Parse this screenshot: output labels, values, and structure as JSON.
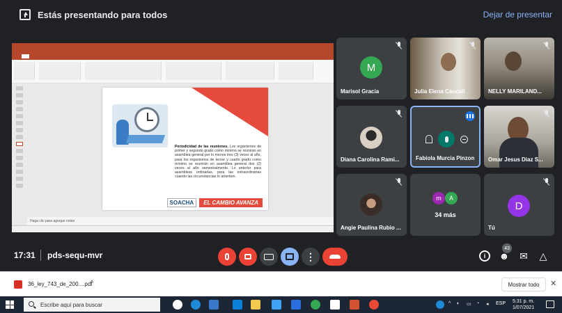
{
  "banner": {
    "presenting_text": "Estás presentando para todos",
    "stop_label": "Dejar de presentar"
  },
  "slide": {
    "heading": "Periodicidad de las reuniones.",
    "body": "Los organismos de primer y segundo grado como mínimo se reunirán en asamblea general por lo menos tres (3) veces al año, para los organismos de tercer y cuarto grado como mínimo se reunirán en asamblea general dos (2) veces al año semestralmente. Lo anterior para asambleas ordinarias, para las extraordinarias cuando las circunstancias lo ameriten.",
    "logo_soacha": "SOACHA",
    "logo_cambio": "EL CAMBIO AVANZA",
    "notes": "Haga clic para agregar notas"
  },
  "participants": [
    {
      "name": "Marisol Gracia",
      "initial": "M",
      "color": "#34a853"
    },
    {
      "name": "Julia Elena Caucali"
    },
    {
      "name": "NELLY MARILAND..."
    },
    {
      "name": "Diana Carolina Rami..."
    },
    {
      "name": "Fabiola Murcia Pinzon"
    },
    {
      "name": "Omar Jesus Diaz S..."
    },
    {
      "name": "Angie Paulina Rubio ..."
    },
    {
      "more_label": "34 más",
      "initial_1": "m",
      "color_1": "#9c27b0",
      "initial_2": "A",
      "color_2": "#34a853"
    },
    {
      "name": "Tú",
      "initial": "D",
      "color": "#9334e6"
    }
  ],
  "controls": {
    "time": "17:31",
    "meeting_code": "pds-sequ-mvr",
    "people_count": "43"
  },
  "downloads": {
    "file_name": "36_ley_743_de_200....pdf",
    "show_all": "Mostrar todo",
    "close": "✕"
  },
  "taskbar": {
    "search_placeholder": "Escribe aquí para buscar",
    "language": "ESP",
    "time": "5:31 p. m.",
    "date": "1/07/2021"
  }
}
